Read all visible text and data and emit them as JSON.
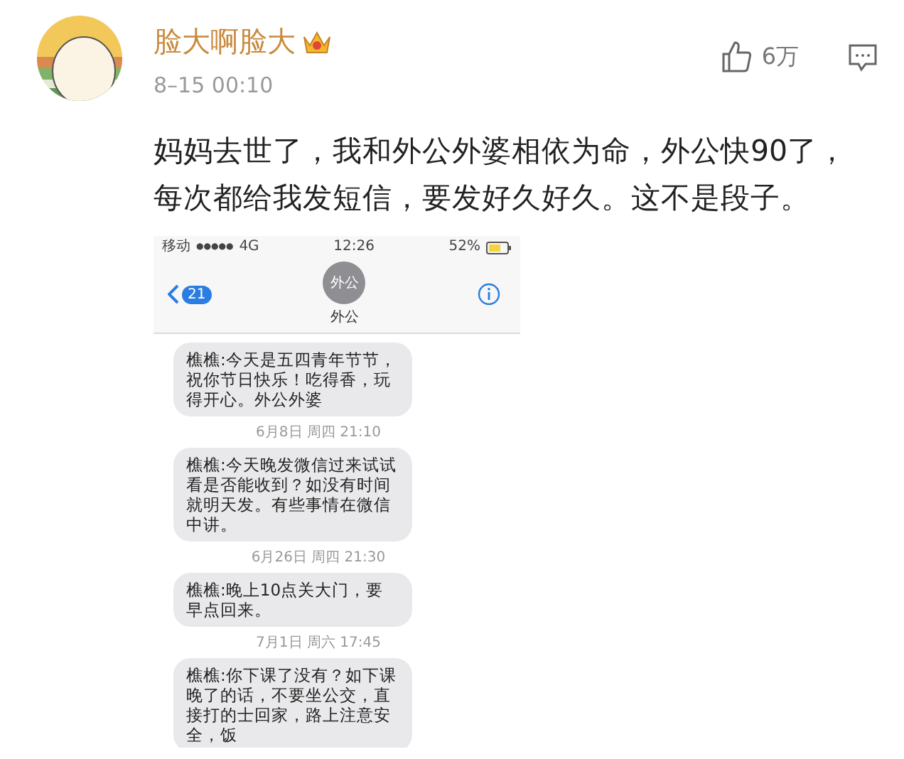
{
  "comment": {
    "author": "脸大啊脸大",
    "time": "8–15 00:10",
    "likes": "6万",
    "text": "妈妈去世了，我和外公外婆相依为命，外公快90了，每次都给我发短信，要发好久好久。这不是段子。"
  },
  "phone": {
    "carrier": "移动",
    "signal": "●●●●●",
    "network": "4G",
    "time": "12:26",
    "battery": "52%",
    "unread": "21",
    "avatar_text": "外公",
    "contact": "外公",
    "messages": [
      {
        "kind": "bubble",
        "text": "樵樵:今天是五四青年节节，祝你节日快乐！吃得香，玩得开心。外公外婆"
      },
      {
        "kind": "timestamp",
        "text": "6月8日 周四 21:10"
      },
      {
        "kind": "bubble",
        "text": "樵樵:今天晚发微信过来试试看是否能收到？如没有时间就明天发。有些事情在微信中讲。"
      },
      {
        "kind": "timestamp",
        "text": "6月26日 周四 21:30"
      },
      {
        "kind": "bubble",
        "text": "樵樵:晚上10点关大门，要早点回来。"
      },
      {
        "kind": "timestamp",
        "text": "7月1日 周六 17:45"
      },
      {
        "kind": "bubble",
        "text": "樵樵:你下课了没有？如下课晚了的话，不要坐公交，直接打的士回家，路上注意安全，饭"
      }
    ]
  }
}
